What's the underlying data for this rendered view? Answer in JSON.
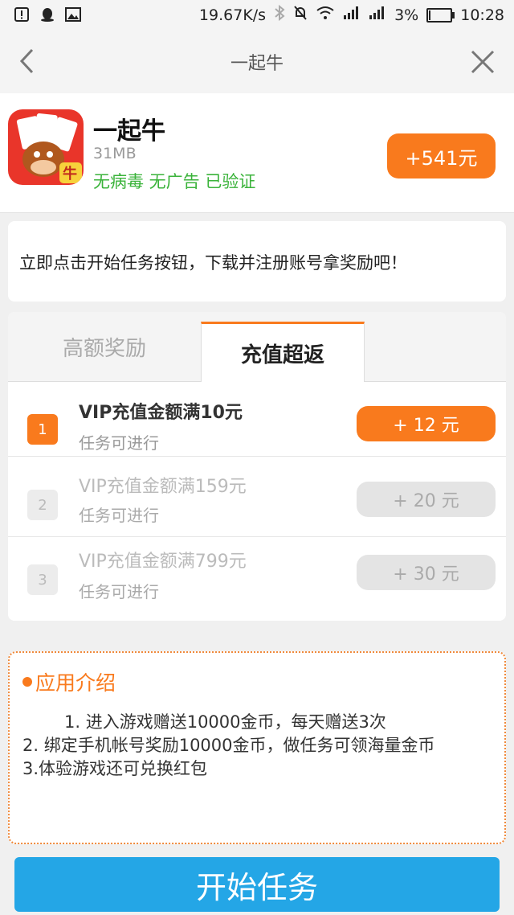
{
  "status_bar": {
    "net_speed": "19.67K/s",
    "battery_pct": "3%",
    "time": "10:28",
    "icons": [
      "alert-icon",
      "qq-icon",
      "image-icon",
      "bluetooth-icon",
      "mute-icon",
      "wifi-icon",
      "signal-icon",
      "signal-icon-2",
      "battery-icon"
    ]
  },
  "nav": {
    "title": "一起牛",
    "back_icon": "chevron-left-icon",
    "close_icon": "close-icon"
  },
  "app": {
    "name": "一起牛",
    "size": "31MB",
    "tags": "无病毒 无广告 已验证",
    "reward": "+541元",
    "icon_badge": "牛"
  },
  "instruction": "立即点击开始任务按钮，下载并注册账号拿奖励吧！",
  "tabs": [
    {
      "label": "高额奖励"
    },
    {
      "label": "充值超返"
    }
  ],
  "tasks": [
    {
      "num": "1",
      "title": "VIP充值金额满10元",
      "status": "任务可进行",
      "reward": "+ 12 元",
      "active": true
    },
    {
      "num": "2",
      "title": "VIP充值金额满159元",
      "status": "任务可进行",
      "reward": "+ 20 元",
      "active": false
    },
    {
      "num": "3",
      "title": "VIP充值金额满799元",
      "status": "任务可进行",
      "reward": "+ 30 元",
      "active": false
    }
  ],
  "intro": {
    "title": "应用介绍",
    "line1": "1. 进入游戏赠送10000金币，每天赠送3次",
    "line2": "2. 绑定手机帐号奖励10000金币，做任务可领海量金币",
    "line3": "3.体验游戏还可兑换红包"
  },
  "start_button": "开始任务",
  "colors": {
    "accent": "#f97a1d",
    "primary_blue": "#24a6e6",
    "tag_green": "#3bb33b"
  }
}
